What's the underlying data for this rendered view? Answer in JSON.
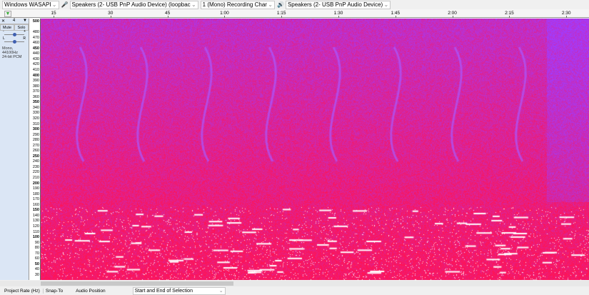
{
  "device_toolbar": {
    "host": "Windows WASAPI",
    "recording_device": "Speakers (2- USB PnP Audio Device) (loopbac",
    "channels": "1 (Mono) Recording Char",
    "playback_device": "Speakers (2- USB PnP Audio Device)"
  },
  "timeline": {
    "ticks": [
      "15",
      "30",
      "45",
      "1:00",
      "1:15",
      "1:30",
      "1:45",
      "2:00",
      "2:15",
      "2:30"
    ]
  },
  "track": {
    "name": "4",
    "mute": "Mute",
    "solo": "Solo",
    "gain_left": "-",
    "gain_right": "+",
    "pan_left": "L",
    "pan_right": "R",
    "info_line1": "Mono, 44100Hz",
    "info_line2": "24-bit PCM",
    "gain_level": 0.5,
    "pan_level": 0.5
  },
  "y_axis": {
    "labels": [
      "500",
      "480",
      "470",
      "460",
      "450",
      "440",
      "430",
      "420",
      "410",
      "400",
      "390",
      "380",
      "370",
      "360",
      "350",
      "340",
      "330",
      "320",
      "310",
      "300",
      "290",
      "280",
      "270",
      "260",
      "250",
      "240",
      "230",
      "220",
      "210",
      "200",
      "190",
      "180",
      "170",
      "160",
      "150",
      "140",
      "130",
      "120",
      "110",
      "100",
      "90",
      "80",
      "70",
      "60",
      "50",
      "40",
      "30"
    ]
  },
  "colors": {
    "spectrogram_high": "#ff1e5a",
    "spectrogram_low": "#a050ff",
    "peak": "#ffffff"
  },
  "status_bar": {
    "project_rate_label": "Project Rate (Hz)",
    "snap_to_label": "Snap-To",
    "audio_position_label": "Audio Position",
    "selection_mode": "Start and End of Selection"
  }
}
